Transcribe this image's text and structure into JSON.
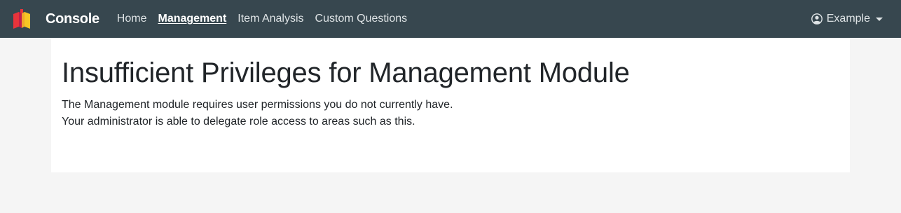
{
  "navbar": {
    "brand_name": "Console",
    "links": [
      {
        "label": "Home",
        "active": false
      },
      {
        "label": "Management",
        "active": true
      },
      {
        "label": "Item Analysis",
        "active": false
      },
      {
        "label": "Custom Questions",
        "active": false
      }
    ],
    "user": {
      "name": "Example",
      "icon": "user-circle-icon"
    },
    "logo_icon": "book-logo-icon",
    "logo_colors": [
      "#e8343b",
      "#f0a62a",
      "#f6c624"
    ],
    "background_color": "#37474f"
  },
  "main": {
    "title": "Insufficient Privileges for Management Module",
    "lines": [
      "The Management module requires user permissions you do not currently have.",
      "Your administrator is able to delegate role access to areas such as this."
    ]
  }
}
